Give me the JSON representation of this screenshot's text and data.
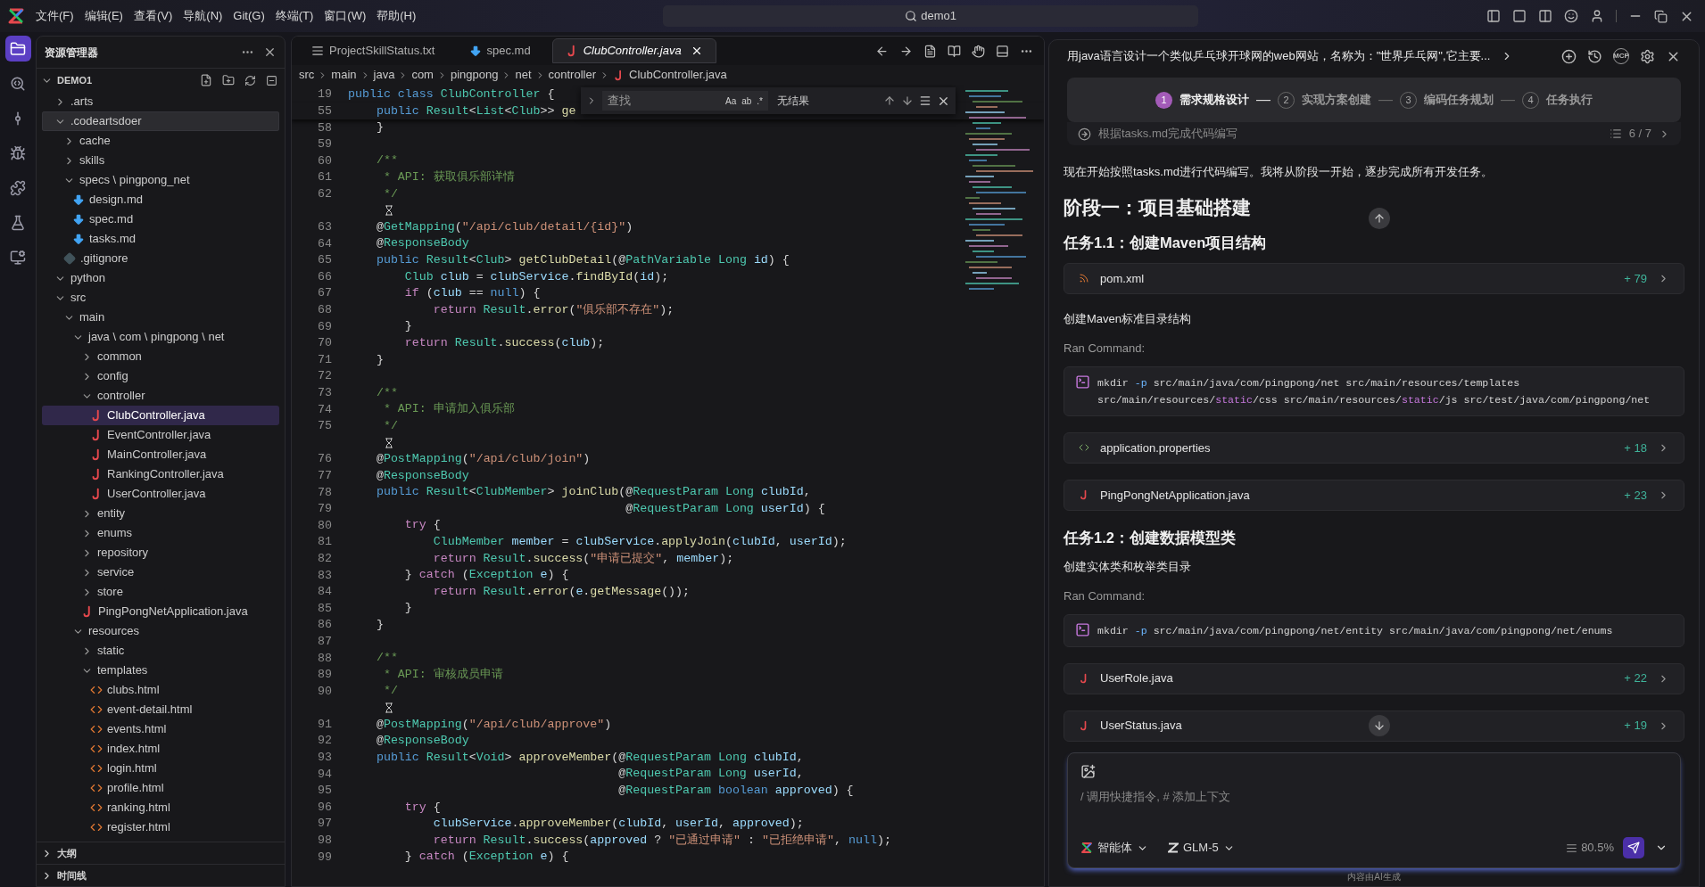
{
  "title_bar": {
    "menu": [
      "文件(F)",
      "编辑(E)",
      "查看(V)",
      "导航(N)",
      "Git(G)",
      "终端(T)",
      "窗口(W)",
      "帮助(H)"
    ],
    "search": "demo1"
  },
  "activity_bar": [
    {
      "kind": "explorer",
      "selected": true
    },
    {
      "kind": "search",
      "selected": false
    },
    {
      "kind": "source",
      "selected": false
    },
    {
      "kind": "debug",
      "selected": false
    },
    {
      "kind": "extensions",
      "selected": false
    },
    {
      "kind": "test",
      "selected": false
    },
    {
      "kind": "remote",
      "selected": false
    }
  ],
  "explorer": {
    "title": "资源管理器",
    "root": {
      "label": "DEMO1",
      "expanded": true
    },
    "tree": [
      {
        "label": ".arts",
        "kind": "folder",
        "expanded": false,
        "selected": false,
        "hovered": false
      },
      {
        "label": ".codeartsdoer",
        "kind": "folder",
        "expanded": true,
        "selected": false,
        "hovered": true,
        "children": [
          {
            "label": "cache",
            "kind": "folder",
            "expanded": false,
            "selected": false,
            "hovered": false
          },
          {
            "label": "skills",
            "kind": "folder",
            "expanded": false,
            "selected": false,
            "hovered": false
          },
          {
            "label": "specs \\ pingpong_net",
            "kind": "folder",
            "expanded": true,
            "selected": false,
            "hovered": false,
            "children": [
              {
                "label": "design.md",
                "kind": "md",
                "selected": false,
                "hovered": false
              },
              {
                "label": "spec.md",
                "kind": "md",
                "selected": false,
                "hovered": false
              },
              {
                "label": "tasks.md",
                "kind": "md",
                "selected": false,
                "hovered": false
              }
            ]
          },
          {
            "label": ".gitignore",
            "kind": "git",
            "selected": false,
            "hovered": false
          }
        ]
      },
      {
        "label": "python",
        "kind": "folder",
        "expanded": true,
        "selected": false,
        "hovered": false
      },
      {
        "label": "src",
        "kind": "folder",
        "expanded": true,
        "selected": false,
        "hovered": false,
        "children": [
          {
            "label": "main",
            "kind": "folder",
            "expanded": true,
            "selected": false,
            "hovered": false,
            "children": [
              {
                "label": "java \\ com \\ pingpong \\ net",
                "kind": "folder",
                "expanded": true,
                "selected": false,
                "hovered": false,
                "children": [
                  {
                    "label": "common",
                    "kind": "folder",
                    "expanded": false,
                    "selected": false,
                    "hovered": false
                  },
                  {
                    "label": "config",
                    "kind": "folder",
                    "expanded": false,
                    "selected": false,
                    "hovered": false
                  },
                  {
                    "label": "controller",
                    "kind": "folder",
                    "expanded": true,
                    "selected": false,
                    "hovered": false,
                    "children": [
                      {
                        "label": "ClubController.java",
                        "kind": "java",
                        "selected": true,
                        "hovered": false
                      },
                      {
                        "label": "EventController.java",
                        "kind": "java",
                        "selected": false,
                        "hovered": false
                      },
                      {
                        "label": "MainController.java",
                        "kind": "java",
                        "selected": false,
                        "hovered": false
                      },
                      {
                        "label": "RankingController.java",
                        "kind": "java",
                        "selected": false,
                        "hovered": false
                      },
                      {
                        "label": "UserController.java",
                        "kind": "java",
                        "selected": false,
                        "hovered": false
                      }
                    ]
                  },
                  {
                    "label": "entity",
                    "kind": "folder",
                    "expanded": false,
                    "selected": false,
                    "hovered": false
                  },
                  {
                    "label": "enums",
                    "kind": "folder",
                    "expanded": false,
                    "selected": false,
                    "hovered": false
                  },
                  {
                    "label": "repository",
                    "kind": "folder",
                    "expanded": false,
                    "selected": false,
                    "hovered": false
                  },
                  {
                    "label": "service",
                    "kind": "folder",
                    "expanded": false,
                    "selected": false,
                    "hovered": false
                  },
                  {
                    "label": "store",
                    "kind": "folder",
                    "expanded": false,
                    "selected": false,
                    "hovered": false
                  },
                  {
                    "label": "PingPongNetApplication.java",
                    "kind": "java",
                    "selected": false,
                    "hovered": false
                  }
                ]
              },
              {
                "label": "resources",
                "kind": "folder",
                "expanded": true,
                "selected": false,
                "hovered": false,
                "children": [
                  {
                    "label": "static",
                    "kind": "folder",
                    "expanded": false,
                    "selected": false,
                    "hovered": false
                  },
                  {
                    "label": "templates",
                    "kind": "folder",
                    "expanded": true,
                    "selected": false,
                    "hovered": false,
                    "children": [
                      {
                        "label": "clubs.html",
                        "kind": "html",
                        "selected": false,
                        "hovered": false
                      },
                      {
                        "label": "event-detail.html",
                        "kind": "html",
                        "selected": false,
                        "hovered": false
                      },
                      {
                        "label": "events.html",
                        "kind": "html",
                        "selected": false,
                        "hovered": false
                      },
                      {
                        "label": "index.html",
                        "kind": "html",
                        "selected": false,
                        "hovered": false
                      },
                      {
                        "label": "login.html",
                        "kind": "html",
                        "selected": false,
                        "hovered": false
                      },
                      {
                        "label": "profile.html",
                        "kind": "html",
                        "selected": false,
                        "hovered": false
                      },
                      {
                        "label": "ranking.html",
                        "kind": "html",
                        "selected": false,
                        "hovered": false
                      },
                      {
                        "label": "register.html",
                        "kind": "html",
                        "selected": false,
                        "hovered": false
                      }
                    ]
                  }
                ]
              }
            ]
          }
        ]
      }
    ],
    "sections": [
      {
        "label": "大纲",
        "expanded": false
      },
      {
        "label": "时间线",
        "expanded": false
      }
    ]
  },
  "editor": {
    "tabs": [
      {
        "label": "ProjectSkillStatus.txt",
        "kind": "txt",
        "selected": false
      },
      {
        "label": "spec.md",
        "kind": "md",
        "selected": false
      },
      {
        "label": "ClubController.java",
        "kind": "java",
        "selected": true
      }
    ],
    "breadcrumb": [
      {
        "label": "src",
        "kind": "folder"
      },
      {
        "label": "main",
        "kind": "folder"
      },
      {
        "label": "java",
        "kind": "folder"
      },
      {
        "label": "com",
        "kind": "folder"
      },
      {
        "label": "pingpong",
        "kind": "folder"
      },
      {
        "label": "net",
        "kind": "folder"
      },
      {
        "label": "controller",
        "kind": "folder"
      },
      {
        "label": "ClubController.java",
        "kind": "java"
      }
    ],
    "find": {
      "placeholder": "查找",
      "options": [
        "Aa",
        "ab",
        ".*"
      ],
      "result": "无结果"
    },
    "lines": [
      {
        "kind": "code",
        "number": "19",
        "tokens": [
          {
            "kind": "kw",
            "text": "public class "
          },
          {
            "kind": "type",
            "text": "ClubController"
          },
          {
            "kind": "plain",
            "text": " {"
          }
        ]
      },
      {
        "kind": "code",
        "number": "55",
        "tokens": [
          {
            "kind": "kw",
            "text": "    public "
          },
          {
            "kind": "type",
            "text": "Result"
          },
          {
            "kind": "plain",
            "text": "<"
          },
          {
            "kind": "type",
            "text": "List"
          },
          {
            "kind": "plain",
            "text": "<"
          },
          {
            "kind": "type",
            "text": "Club"
          },
          {
            "kind": "plain",
            "text": ">> "
          },
          {
            "kind": "fn",
            "text": "ge"
          }
        ]
      },
      {
        "kind": "code",
        "number": "58",
        "tokens": [
          {
            "kind": "plain",
            "text": "    }"
          }
        ]
      },
      {
        "kind": "code",
        "number": "59"
      },
      {
        "kind": "code",
        "number": "60",
        "tokens": [
          {
            "kind": "cmt",
            "text": "    /**"
          }
        ]
      },
      {
        "kind": "code",
        "number": "61",
        "tokens": [
          {
            "kind": "cmt",
            "text": "     * API: 获取俱乐部详情"
          }
        ]
      },
      {
        "kind": "code",
        "number": "62",
        "tokens": [
          {
            "kind": "cmt",
            "text": "     */"
          }
        ]
      },
      {
        "kind": "lens"
      },
      {
        "kind": "code",
        "number": "63",
        "tokens": [
          {
            "kind": "plain",
            "text": "    @"
          },
          {
            "kind": "type",
            "text": "GetMapping"
          },
          {
            "kind": "plain",
            "text": "("
          },
          {
            "kind": "str",
            "text": "\"/api/club/detail/{id}\""
          },
          {
            "kind": "plain",
            "text": ")"
          }
        ]
      },
      {
        "kind": "code",
        "number": "64",
        "tokens": [
          {
            "kind": "plain",
            "text": "    @"
          },
          {
            "kind": "type",
            "text": "ResponseBody"
          }
        ]
      },
      {
        "kind": "code",
        "number": "65",
        "tokens": [
          {
            "kind": "kw",
            "text": "    public "
          },
          {
            "kind": "type",
            "text": "Result"
          },
          {
            "kind": "plain",
            "text": "<"
          },
          {
            "kind": "type",
            "text": "Club"
          },
          {
            "kind": "plain",
            "text": "> "
          },
          {
            "kind": "fn",
            "text": "getClubDetail"
          },
          {
            "kind": "plain",
            "text": "(@"
          },
          {
            "kind": "type",
            "text": "PathVariable Long "
          },
          {
            "kind": "var",
            "text": "id"
          },
          {
            "kind": "plain",
            "text": ") {"
          }
        ]
      },
      {
        "kind": "code",
        "number": "66",
        "tokens": [
          {
            "kind": "type",
            "text": "        Club "
          },
          {
            "kind": "var",
            "text": "club"
          },
          {
            "kind": "plain",
            "text": " = "
          },
          {
            "kind": "var",
            "text": "clubService"
          },
          {
            "kind": "plain",
            "text": "."
          },
          {
            "kind": "fn",
            "text": "findById"
          },
          {
            "kind": "plain",
            "text": "("
          },
          {
            "kind": "var",
            "text": "id"
          },
          {
            "kind": "plain",
            "text": ");"
          }
        ]
      },
      {
        "kind": "code",
        "number": "67",
        "tokens": [
          {
            "kind": "ctl",
            "text": "        if"
          },
          {
            "kind": "plain",
            "text": " ("
          },
          {
            "kind": "var",
            "text": "club"
          },
          {
            "kind": "plain",
            "text": " == "
          },
          {
            "kind": "kw",
            "text": "null"
          },
          {
            "kind": "plain",
            "text": ") {"
          }
        ]
      },
      {
        "kind": "code",
        "number": "68",
        "tokens": [
          {
            "kind": "ctl",
            "text": "            return "
          },
          {
            "kind": "type",
            "text": "Result"
          },
          {
            "kind": "plain",
            "text": "."
          },
          {
            "kind": "fn",
            "text": "error"
          },
          {
            "kind": "plain",
            "text": "("
          },
          {
            "kind": "str",
            "text": "\"俱乐部不存在\""
          },
          {
            "kind": "plain",
            "text": ");"
          }
        ]
      },
      {
        "kind": "code",
        "number": "69",
        "tokens": [
          {
            "kind": "plain",
            "text": "        }"
          }
        ]
      },
      {
        "kind": "code",
        "number": "70",
        "tokens": [
          {
            "kind": "ctl",
            "text": "        return "
          },
          {
            "kind": "type",
            "text": "Result"
          },
          {
            "kind": "plain",
            "text": "."
          },
          {
            "kind": "fn",
            "text": "success"
          },
          {
            "kind": "plain",
            "text": "("
          },
          {
            "kind": "var",
            "text": "club"
          },
          {
            "kind": "plain",
            "text": ");"
          }
        ]
      },
      {
        "kind": "code",
        "number": "71",
        "tokens": [
          {
            "kind": "plain",
            "text": "    }"
          }
        ]
      },
      {
        "kind": "code",
        "number": "72"
      },
      {
        "kind": "code",
        "number": "73",
        "tokens": [
          {
            "kind": "cmt",
            "text": "    /**"
          }
        ]
      },
      {
        "kind": "code",
        "number": "74",
        "tokens": [
          {
            "kind": "cmt",
            "text": "     * API: 申请加入俱乐部"
          }
        ]
      },
      {
        "kind": "code",
        "number": "75",
        "tokens": [
          {
            "kind": "cmt",
            "text": "     */"
          }
        ]
      },
      {
        "kind": "lens"
      },
      {
        "kind": "code",
        "number": "76",
        "tokens": [
          {
            "kind": "plain",
            "text": "    @"
          },
          {
            "kind": "type",
            "text": "PostMapping"
          },
          {
            "kind": "plain",
            "text": "("
          },
          {
            "kind": "str",
            "text": "\"/api/club/join\""
          },
          {
            "kind": "plain",
            "text": ")"
          }
        ]
      },
      {
        "kind": "code",
        "number": "77",
        "tokens": [
          {
            "kind": "plain",
            "text": "    @"
          },
          {
            "kind": "type",
            "text": "ResponseBody"
          }
        ]
      },
      {
        "kind": "code",
        "number": "78",
        "tokens": [
          {
            "kind": "kw",
            "text": "    public "
          },
          {
            "kind": "type",
            "text": "Result"
          },
          {
            "kind": "plain",
            "text": "<"
          },
          {
            "kind": "type",
            "text": "ClubMember"
          },
          {
            "kind": "plain",
            "text": "> "
          },
          {
            "kind": "fn",
            "text": "joinClub"
          },
          {
            "kind": "plain",
            "text": "(@"
          },
          {
            "kind": "type",
            "text": "RequestParam Long "
          },
          {
            "kind": "var",
            "text": "clubId"
          },
          {
            "kind": "plain",
            "text": ","
          }
        ]
      },
      {
        "kind": "code",
        "number": "79",
        "tokens": [
          {
            "kind": "plain",
            "text": "                                       @"
          },
          {
            "kind": "type",
            "text": "RequestParam Long "
          },
          {
            "kind": "var",
            "text": "userId"
          },
          {
            "kind": "plain",
            "text": ") {"
          }
        ]
      },
      {
        "kind": "code",
        "number": "80",
        "tokens": [
          {
            "kind": "ctl",
            "text": "        try"
          },
          {
            "kind": "plain",
            "text": " {"
          }
        ]
      },
      {
        "kind": "code",
        "number": "81",
        "tokens": [
          {
            "kind": "type",
            "text": "            ClubMember "
          },
          {
            "kind": "var",
            "text": "member"
          },
          {
            "kind": "plain",
            "text": " = "
          },
          {
            "kind": "var",
            "text": "clubService"
          },
          {
            "kind": "plain",
            "text": "."
          },
          {
            "kind": "fn",
            "text": "applyJoin"
          },
          {
            "kind": "plain",
            "text": "("
          },
          {
            "kind": "var",
            "text": "clubId"
          },
          {
            "kind": "plain",
            "text": ", "
          },
          {
            "kind": "var",
            "text": "userId"
          },
          {
            "kind": "plain",
            "text": ");"
          }
        ]
      },
      {
        "kind": "code",
        "number": "82",
        "tokens": [
          {
            "kind": "ctl",
            "text": "            return "
          },
          {
            "kind": "type",
            "text": "Result"
          },
          {
            "kind": "plain",
            "text": "."
          },
          {
            "kind": "fn",
            "text": "success"
          },
          {
            "kind": "plain",
            "text": "("
          },
          {
            "kind": "str",
            "text": "\"申请已提交\""
          },
          {
            "kind": "plain",
            "text": ", "
          },
          {
            "kind": "var",
            "text": "member"
          },
          {
            "kind": "plain",
            "text": ");"
          }
        ]
      },
      {
        "kind": "code",
        "number": "83",
        "tokens": [
          {
            "kind": "plain",
            "text": "        } "
          },
          {
            "kind": "ctl",
            "text": "catch"
          },
          {
            "kind": "plain",
            "text": " ("
          },
          {
            "kind": "type",
            "text": "Exception "
          },
          {
            "kind": "var",
            "text": "e"
          },
          {
            "kind": "plain",
            "text": ") {"
          }
        ]
      },
      {
        "kind": "code",
        "number": "84",
        "tokens": [
          {
            "kind": "ctl",
            "text": "            return "
          },
          {
            "kind": "type",
            "text": "Result"
          },
          {
            "kind": "plain",
            "text": "."
          },
          {
            "kind": "fn",
            "text": "error"
          },
          {
            "kind": "plain",
            "text": "("
          },
          {
            "kind": "var",
            "text": "e"
          },
          {
            "kind": "plain",
            "text": "."
          },
          {
            "kind": "fn",
            "text": "getMessage"
          },
          {
            "kind": "plain",
            "text": "());"
          }
        ]
      },
      {
        "kind": "code",
        "number": "85",
        "tokens": [
          {
            "kind": "plain",
            "text": "        }"
          }
        ]
      },
      {
        "kind": "code",
        "number": "86",
        "tokens": [
          {
            "kind": "plain",
            "text": "    }"
          }
        ]
      },
      {
        "kind": "code",
        "number": "87"
      },
      {
        "kind": "code",
        "number": "88",
        "tokens": [
          {
            "kind": "cmt",
            "text": "    /**"
          }
        ]
      },
      {
        "kind": "code",
        "number": "89",
        "tokens": [
          {
            "kind": "cmt",
            "text": "     * API: 审核成员申请"
          }
        ]
      },
      {
        "kind": "code",
        "number": "90",
        "tokens": [
          {
            "kind": "cmt",
            "text": "     */"
          }
        ]
      },
      {
        "kind": "lens"
      },
      {
        "kind": "code",
        "number": "91",
        "tokens": [
          {
            "kind": "plain",
            "text": "    @"
          },
          {
            "kind": "type",
            "text": "PostMapping"
          },
          {
            "kind": "plain",
            "text": "("
          },
          {
            "kind": "str",
            "text": "\"/api/club/approve\""
          },
          {
            "kind": "plain",
            "text": ")"
          }
        ]
      },
      {
        "kind": "code",
        "number": "92",
        "tokens": [
          {
            "kind": "plain",
            "text": "    @"
          },
          {
            "kind": "type",
            "text": "ResponseBody"
          }
        ]
      },
      {
        "kind": "code",
        "number": "93",
        "tokens": [
          {
            "kind": "kw",
            "text": "    public "
          },
          {
            "kind": "type",
            "text": "Result"
          },
          {
            "kind": "plain",
            "text": "<"
          },
          {
            "kind": "type",
            "text": "Void"
          },
          {
            "kind": "plain",
            "text": "> "
          },
          {
            "kind": "fn",
            "text": "approveMember"
          },
          {
            "kind": "plain",
            "text": "(@"
          },
          {
            "kind": "type",
            "text": "RequestParam Long "
          },
          {
            "kind": "var",
            "text": "clubId"
          },
          {
            "kind": "plain",
            "text": ","
          }
        ]
      },
      {
        "kind": "code",
        "number": "94",
        "tokens": [
          {
            "kind": "plain",
            "text": "                                      @"
          },
          {
            "kind": "type",
            "text": "RequestParam Long "
          },
          {
            "kind": "var",
            "text": "userId"
          },
          {
            "kind": "plain",
            "text": ","
          }
        ]
      },
      {
        "kind": "code",
        "number": "95",
        "tokens": [
          {
            "kind": "plain",
            "text": "                                      @"
          },
          {
            "kind": "type",
            "text": "RequestParam "
          },
          {
            "kind": "kw",
            "text": "boolean "
          },
          {
            "kind": "var",
            "text": "approved"
          },
          {
            "kind": "plain",
            "text": ") {"
          }
        ]
      },
      {
        "kind": "code",
        "number": "96",
        "tokens": [
          {
            "kind": "ctl",
            "text": "        try"
          },
          {
            "kind": "plain",
            "text": " {"
          }
        ]
      },
      {
        "kind": "code",
        "number": "97",
        "tokens": [
          {
            "kind": "var",
            "text": "            clubService"
          },
          {
            "kind": "plain",
            "text": "."
          },
          {
            "kind": "fn",
            "text": "approveMember"
          },
          {
            "kind": "plain",
            "text": "("
          },
          {
            "kind": "var",
            "text": "clubId"
          },
          {
            "kind": "plain",
            "text": ", "
          },
          {
            "kind": "var",
            "text": "userId"
          },
          {
            "kind": "plain",
            "text": ", "
          },
          {
            "kind": "var",
            "text": "approved"
          },
          {
            "kind": "plain",
            "text": ");"
          }
        ]
      },
      {
        "kind": "code",
        "number": "98",
        "tokens": [
          {
            "kind": "ctl",
            "text": "            return "
          },
          {
            "kind": "type",
            "text": "Result"
          },
          {
            "kind": "plain",
            "text": "."
          },
          {
            "kind": "fn",
            "text": "success"
          },
          {
            "kind": "plain",
            "text": "("
          },
          {
            "kind": "var",
            "text": "approved"
          },
          {
            "kind": "plain",
            "text": " ? "
          },
          {
            "kind": "str",
            "text": "\"已通过申请\""
          },
          {
            "kind": "plain",
            "text": " : "
          },
          {
            "kind": "str",
            "text": "\"已拒绝申请\""
          },
          {
            "kind": "plain",
            "text": ", "
          },
          {
            "kind": "kw",
            "text": "null"
          },
          {
            "kind": "plain",
            "text": ");"
          }
        ]
      },
      {
        "kind": "code",
        "number": "99",
        "tokens": [
          {
            "kind": "plain",
            "text": "        } "
          },
          {
            "kind": "ctl",
            "text": "catch"
          },
          {
            "kind": "plain",
            "text": " ("
          },
          {
            "kind": "type",
            "text": "Exception "
          },
          {
            "kind": "var",
            "text": "e"
          },
          {
            "kind": "plain",
            "text": ") {"
          }
        ]
      }
    ]
  },
  "assistant": {
    "title": "用java语言设计一个类似乒乓球开球网的web网站，名称为：\"世界乒乓网\",它主要...",
    "mcp_label": "MCP",
    "steps": [
      {
        "number": "1",
        "label": "需求规格设计",
        "selected": true,
        "separator": "—"
      },
      {
        "number": "2",
        "label": "实现方案创建",
        "selected": false,
        "separator": "—"
      },
      {
        "number": "3",
        "label": "编码任务规划",
        "selected": false,
        "separator": "—"
      },
      {
        "number": "4",
        "label": "任务执行",
        "selected": false
      }
    ],
    "task": {
      "label": "根据tasks.md完成代码编写",
      "progress": "6 / 7"
    },
    "messages": [
      {
        "kind": "paragraph",
        "text": "现在开始按照tasks.md进行代码编写。我将从阶段一开始，逐步完成所有开发任务。"
      },
      {
        "kind": "h2",
        "text": "阶段一：项目基础搭建"
      },
      {
        "kind": "h3",
        "text": "任务1.1：创建Maven项目结构"
      },
      {
        "kind": "file",
        "file": {
          "kind": "xml",
          "name": "pom.xml",
          "added": "+ 79"
        }
      },
      {
        "kind": "paragraph",
        "text": "创建Maven标准目录结构"
      },
      {
        "kind": "label",
        "text": "Ran Command:"
      },
      {
        "kind": "command",
        "segments": [
          {
            "kind": "plain",
            "text": "mkdir "
          },
          {
            "kind": "flag",
            "text": "-p"
          },
          {
            "kind": "plain",
            "text": " src/main/java/com/pingpong/net src/main/resources/templates src/main/resources/"
          },
          {
            "kind": "hl",
            "text": "static"
          },
          {
            "kind": "plain",
            "text": "/css src/main/resources/"
          },
          {
            "kind": "hl",
            "text": "static"
          },
          {
            "kind": "plain",
            "text": "/js src/test/java/com/pingpong/net"
          }
        ]
      },
      {
        "kind": "file",
        "file": {
          "kind": "properties",
          "name": "application.properties",
          "added": "+ 18"
        }
      },
      {
        "kind": "file",
        "file": {
          "kind": "java",
          "name": "PingPongNetApplication.java",
          "added": "+ 23"
        }
      },
      {
        "kind": "h3",
        "text": "任务1.2：创建数据模型类"
      },
      {
        "kind": "paragraph",
        "text": "创建实体类和枚举类目录"
      },
      {
        "kind": "label",
        "text": "Ran Command:"
      },
      {
        "kind": "command",
        "segments": [
          {
            "kind": "plain",
            "text": "mkdir "
          },
          {
            "kind": "flag",
            "text": "-p"
          },
          {
            "kind": "plain",
            "text": " src/main/java/com/pingpong/net/entity src/main/java/com/pingpong/net/enums"
          }
        ]
      },
      {
        "kind": "file",
        "file": {
          "kind": "java",
          "name": "UserRole.java",
          "added": "+ 22"
        }
      },
      {
        "kind": "file",
        "file": {
          "kind": "java",
          "name": "UserStatus.java",
          "added": "+ 19"
        }
      }
    ],
    "input": {
      "placeholder": "/ 调用快捷指令, # 添加上下文",
      "agent": "智能体",
      "model": "GLM-5",
      "context": "80.5%"
    },
    "footer": "内容由AI生成"
  }
}
